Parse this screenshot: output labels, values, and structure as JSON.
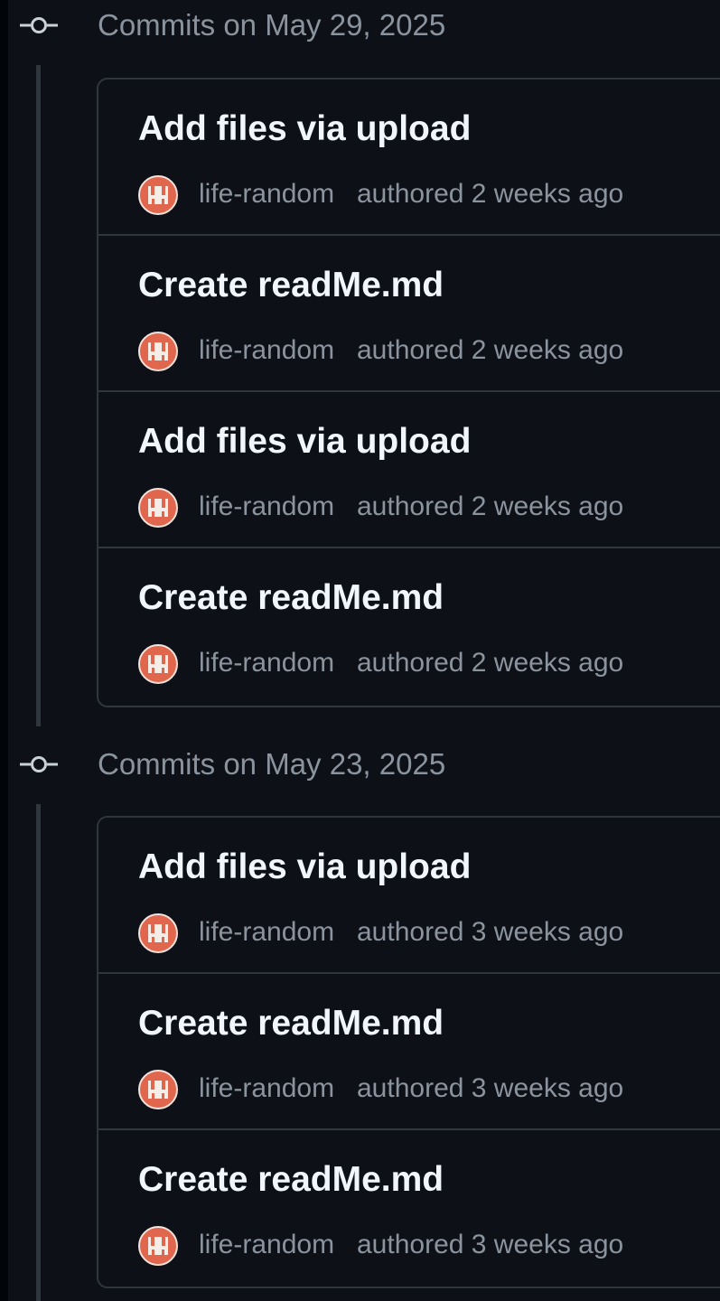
{
  "colors": {
    "background": "#0d1117",
    "border": "#30363d",
    "title_text": "#f0f6fc",
    "muted_text": "#8b949e",
    "avatar_accent": "#e0664d"
  },
  "groups": [
    {
      "header": "Commits on May 29, 2025",
      "icon": "git-commit-icon",
      "commits": [
        {
          "title": "Add files via upload",
          "author": "life-random",
          "meta": "authored 2 weeks ago",
          "avatar_icon": "avatar"
        },
        {
          "title": "Create readMe.md",
          "author": "life-random",
          "meta": "authored 2 weeks ago",
          "avatar_icon": "avatar"
        },
        {
          "title": "Add files via upload",
          "author": "life-random",
          "meta": "authored 2 weeks ago",
          "avatar_icon": "avatar"
        },
        {
          "title": "Create readMe.md",
          "author": "life-random",
          "meta": "authored 2 weeks ago",
          "avatar_icon": "avatar"
        }
      ]
    },
    {
      "header": "Commits on May 23, 2025",
      "icon": "git-commit-icon",
      "commits": [
        {
          "title": "Add files via upload",
          "author": "life-random",
          "meta": "authored 3 weeks ago",
          "avatar_icon": "avatar"
        },
        {
          "title": "Create readMe.md",
          "author": "life-random",
          "meta": "authored 3 weeks ago",
          "avatar_icon": "avatar"
        },
        {
          "title": "Create readMe.md",
          "author": "life-random",
          "meta": "authored 3 weeks ago",
          "avatar_icon": "avatar"
        }
      ]
    }
  ]
}
